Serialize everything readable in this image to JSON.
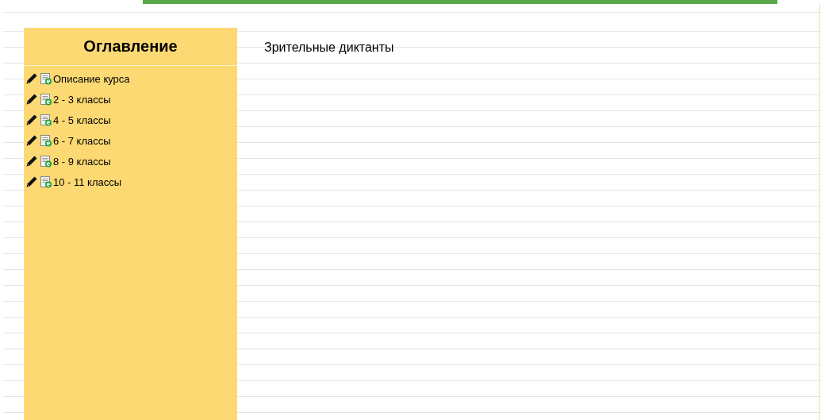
{
  "sidebar": {
    "title": "Оглавление",
    "items": [
      {
        "label": "Описание курса"
      },
      {
        "label": "2 - 3 классы"
      },
      {
        "label": "4 - 5 классы"
      },
      {
        "label": "6 - 7 классы"
      },
      {
        "label": "8 - 9 классы"
      },
      {
        "label": "10 - 11 классы"
      }
    ]
  },
  "content": {
    "title": "Зрительные диктанты"
  }
}
